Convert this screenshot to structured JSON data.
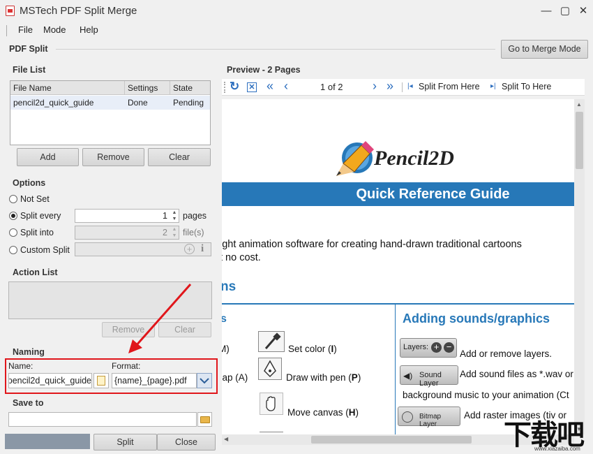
{
  "window": {
    "title": "MSTech PDF Split Merge",
    "minimize": "—",
    "maximize": "▢",
    "close": "✕"
  },
  "menu": [
    "File",
    "Mode",
    "Help"
  ],
  "header": {
    "section_title": "PDF Split",
    "merge_button": "Go to Merge Mode"
  },
  "file_list": {
    "title": "File List",
    "columns": [
      "File Name",
      "Settings",
      "State"
    ],
    "rows": [
      {
        "name": "pencil2d_quick_guide",
        "settings": "Done",
        "state": "Pending"
      }
    ],
    "buttons": {
      "add": "Add",
      "remove": "Remove",
      "clear": "Clear"
    }
  },
  "options": {
    "title": "Options",
    "not_set": "Not Set",
    "split_every": "Split every",
    "split_every_value": "1",
    "split_every_unit": "pages",
    "split_into": "Split into",
    "split_into_value": "2",
    "split_into_unit": "file(s)",
    "custom_split": "Custom Split"
  },
  "action_list": {
    "title": "Action List",
    "remove": "Remove",
    "clear": "Clear"
  },
  "naming": {
    "title": "Naming",
    "name_label": "Name:",
    "name_value": "pencil2d_quick_guide",
    "format_label": "Format:",
    "format_value": "{name}_{page}.pdf"
  },
  "save_to": {
    "title": "Save to",
    "value": ""
  },
  "bottom": {
    "split": "Split",
    "close": "Close"
  },
  "preview": {
    "title": "Preview - 2 Pages",
    "page_indicator": "1 of 2",
    "split_from_here": "Split From Here",
    "split_to_here": "Split To Here"
  },
  "document": {
    "logo_text": "Pencil2D",
    "banner": "Quick Reference Guide",
    "intro_line1": "ight animation software for creating hand-drawn traditional cartoons",
    "intro_line2": "t no cost.",
    "section_heading": "ns",
    "col_heading_left": "s",
    "col_heading_right": "Adding sounds/graphics",
    "tools": [
      {
        "prefix": "M)",
        "label": "Set color (",
        "key": "I",
        "suffix": ")"
      },
      {
        "prefix": "nap (A)",
        "label": "Draw with pen (",
        "key": "P",
        "suffix": ")"
      },
      {
        "prefix": "",
        "label": "Move canvas (",
        "key": "H",
        "suffix": ")"
      }
    ],
    "layers_pill": "Layers:",
    "layers_text": "Add or remove layers.",
    "sound_pill": "Sound Layer",
    "sound_text": "Add sound files as *.wav or",
    "sound_text2": "background music to your animation (Ct",
    "bitmap_pill": "Bitmap Layer",
    "bitmap_text": "Add raster images (tiv or"
  },
  "watermark": {
    "text": "下载吧",
    "url": "www.xiazaiba.com"
  },
  "colors": {
    "accent": "#2778b8",
    "highlight": "#e0161b"
  }
}
